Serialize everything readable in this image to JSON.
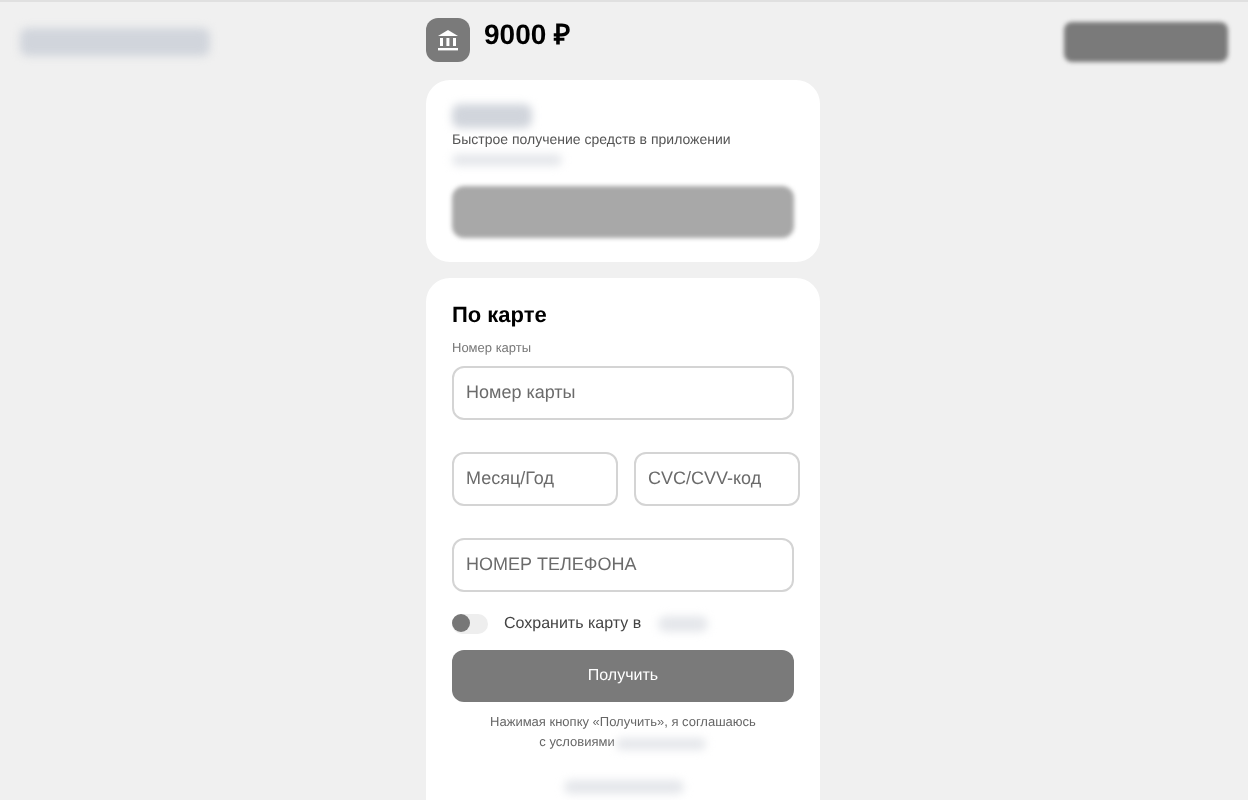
{
  "header": {
    "amount": "9000 ₽"
  },
  "app_card": {
    "subtitle": "Быстрое получение средств в приложении"
  },
  "card_form": {
    "title": "По карте",
    "card_label": "Номер карты",
    "fields": [
      {
        "placeholder": "Номер карты",
        "kind": "full"
      },
      {
        "placeholder": "Месяц/Год",
        "kind": "half"
      },
      {
        "placeholder": "CVC/CVV-код",
        "kind": "half"
      },
      {
        "placeholder": "НОМЕР ТЕЛЕФОНА",
        "kind": "full"
      }
    ],
    "save_toggle": {
      "label": "Сохранить карту в",
      "on": false
    },
    "submit": "Получить",
    "consent": [
      "Нажимая кнопку «Получить», я соглашаюсь",
      "с условиями"
    ]
  }
}
